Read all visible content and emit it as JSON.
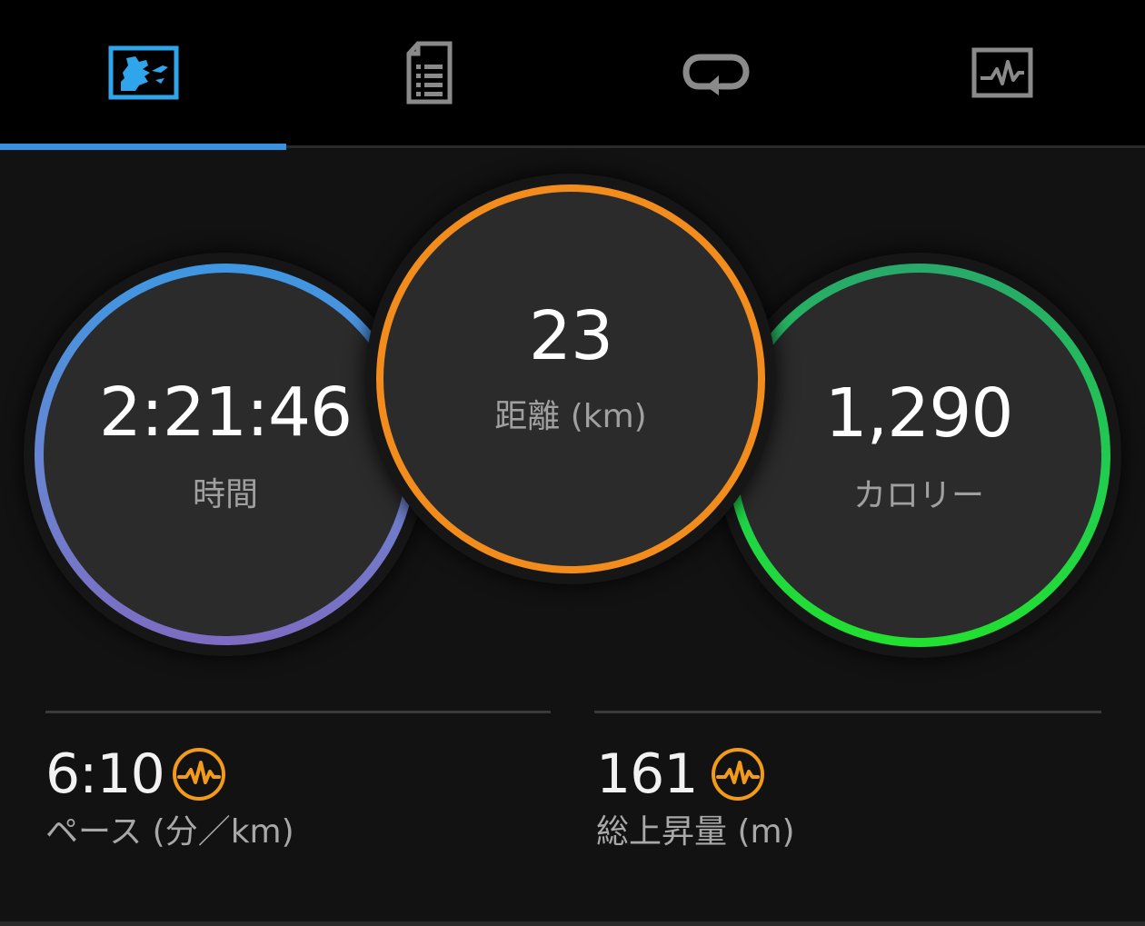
{
  "tabs": [
    {
      "name": "summary",
      "icon": "activity-photo-icon",
      "selected": true
    },
    {
      "name": "details",
      "icon": "document-list-icon",
      "selected": false
    },
    {
      "name": "laps",
      "icon": "loop-icon",
      "selected": false
    },
    {
      "name": "charts",
      "icon": "chart-pulse-icon",
      "selected": false
    }
  ],
  "circles": {
    "time": {
      "value": "2:21:46",
      "label": "時間"
    },
    "distance": {
      "value": "23",
      "label": "距離 (km)"
    },
    "calories": {
      "value": "1,290",
      "label": "カロリー"
    }
  },
  "stats": {
    "pace": {
      "value": "6:10",
      "label": "ペース (分／km)",
      "icon": "pulse-badge-icon"
    },
    "elevation": {
      "value": "161",
      "label": "総上昇量 (m)",
      "icon": "pulse-badge-icon"
    }
  },
  "colors": {
    "accent_tab": "#3a8fe0",
    "time_ring_top": "#3e97e2",
    "time_ring_bottom": "#7d6cc2",
    "distance_ring": "#f28c1c",
    "calorie_ring_top": "#28a86a",
    "calorie_ring_bottom": "#22e030",
    "badge": "#f29a1a"
  }
}
